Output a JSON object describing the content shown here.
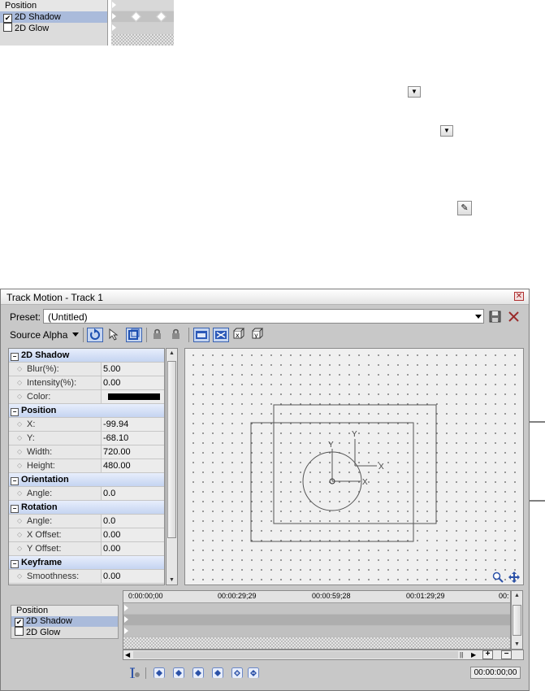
{
  "snippet": {
    "tracks": {
      "header": "Position",
      "row1": "2D Shadow",
      "row2": "2D Glow"
    },
    "row1_checked": "✔",
    "row2_checked": ""
  },
  "dialog": {
    "title": "Track Motion - Track 1",
    "preset_label": "Preset:",
    "preset_value": "(Untitled)",
    "source_alpha": "Source Alpha"
  },
  "props": {
    "shadow": {
      "label": "2D Shadow",
      "blur_name": "Blur(%):",
      "blur_value": "5.00",
      "intensity_name": "Intensity(%):",
      "intensity_value": "0.00",
      "color_name": "Color:",
      "color": "#000000"
    },
    "position": {
      "label": "Position",
      "x_name": "X:",
      "x_value": "-99.94",
      "y_name": "Y:",
      "y_value": "-68.10",
      "width_name": "Width:",
      "width_value": "720.00",
      "height_name": "Height:",
      "height_value": "480.00"
    },
    "orientation": {
      "label": "Orientation",
      "angle_name": "Angle:",
      "angle_value": "0.0"
    },
    "rotation": {
      "label": "Rotation",
      "angle_name": "Angle:",
      "angle_value": "0.0",
      "xoff_name": "X Offset:",
      "xoff_value": "0.00",
      "yoff_name": "Y Offset:",
      "yoff_value": "0.00"
    },
    "keyframe": {
      "label": "Keyframe",
      "smooth_name": "Smoothness:",
      "smooth_value": "0.00"
    }
  },
  "canvas": {
    "axis_x": "X",
    "axis_y": "Y"
  },
  "lower": {
    "tracks": {
      "header": "Position",
      "row1": "2D Shadow",
      "row2": "2D Glow"
    },
    "row1_checked": "✔",
    "row2_checked": "",
    "ruler": {
      "t0": "0:00:00;00",
      "t1": "00:00:29;29",
      "t2": "00:00:59;28",
      "t3": "00:01:29;29",
      "t4": "00:"
    },
    "timecode": "00:00:00;00"
  },
  "colors": {
    "selection": "#aabbdb",
    "category": "#c5d4f1",
    "accent": "#3a62b0",
    "close": "#a02020"
  }
}
